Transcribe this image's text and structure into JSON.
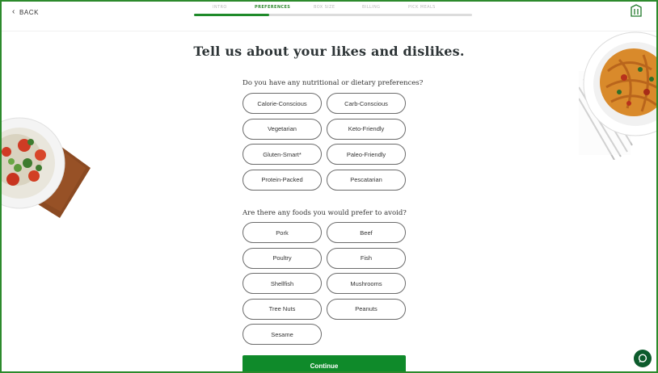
{
  "nav": {
    "back_label": "BACK",
    "steps": [
      "INTRO",
      "PREFERENCES",
      "BOX SIZE",
      "BILLING",
      "PICK MEALS"
    ],
    "active_step": 1,
    "progress": 0.27
  },
  "page": {
    "title": "Tell us about your likes and dislikes."
  },
  "dietary": {
    "question": "Do you have any nutritional or dietary preferences?",
    "options": [
      "Calorie-Conscious",
      "Carb-Conscious",
      "Vegetarian",
      "Keto-Friendly",
      "Gluten-Smart*",
      "Paleo-Friendly",
      "Protein-Packed",
      "Pescatarian"
    ]
  },
  "avoid": {
    "question": "Are there any foods you would prefer to avoid?",
    "options": [
      "Pork",
      "Beef",
      "Poultry",
      "Fish",
      "Shellfish",
      "Mushrooms",
      "Tree Nuts",
      "Peanuts",
      "Sesame"
    ]
  },
  "actions": {
    "continue_label": "Continue"
  },
  "icons": {
    "back": "chevron-left-icon",
    "logo": "brand-logo-icon",
    "chat": "chat-bubble-icon"
  },
  "colors": {
    "brand_green": "#0f8a2a",
    "progress_fill": "#1f8a2a",
    "chat_button": "#0c5b2c",
    "border": "#2c8a2c"
  }
}
